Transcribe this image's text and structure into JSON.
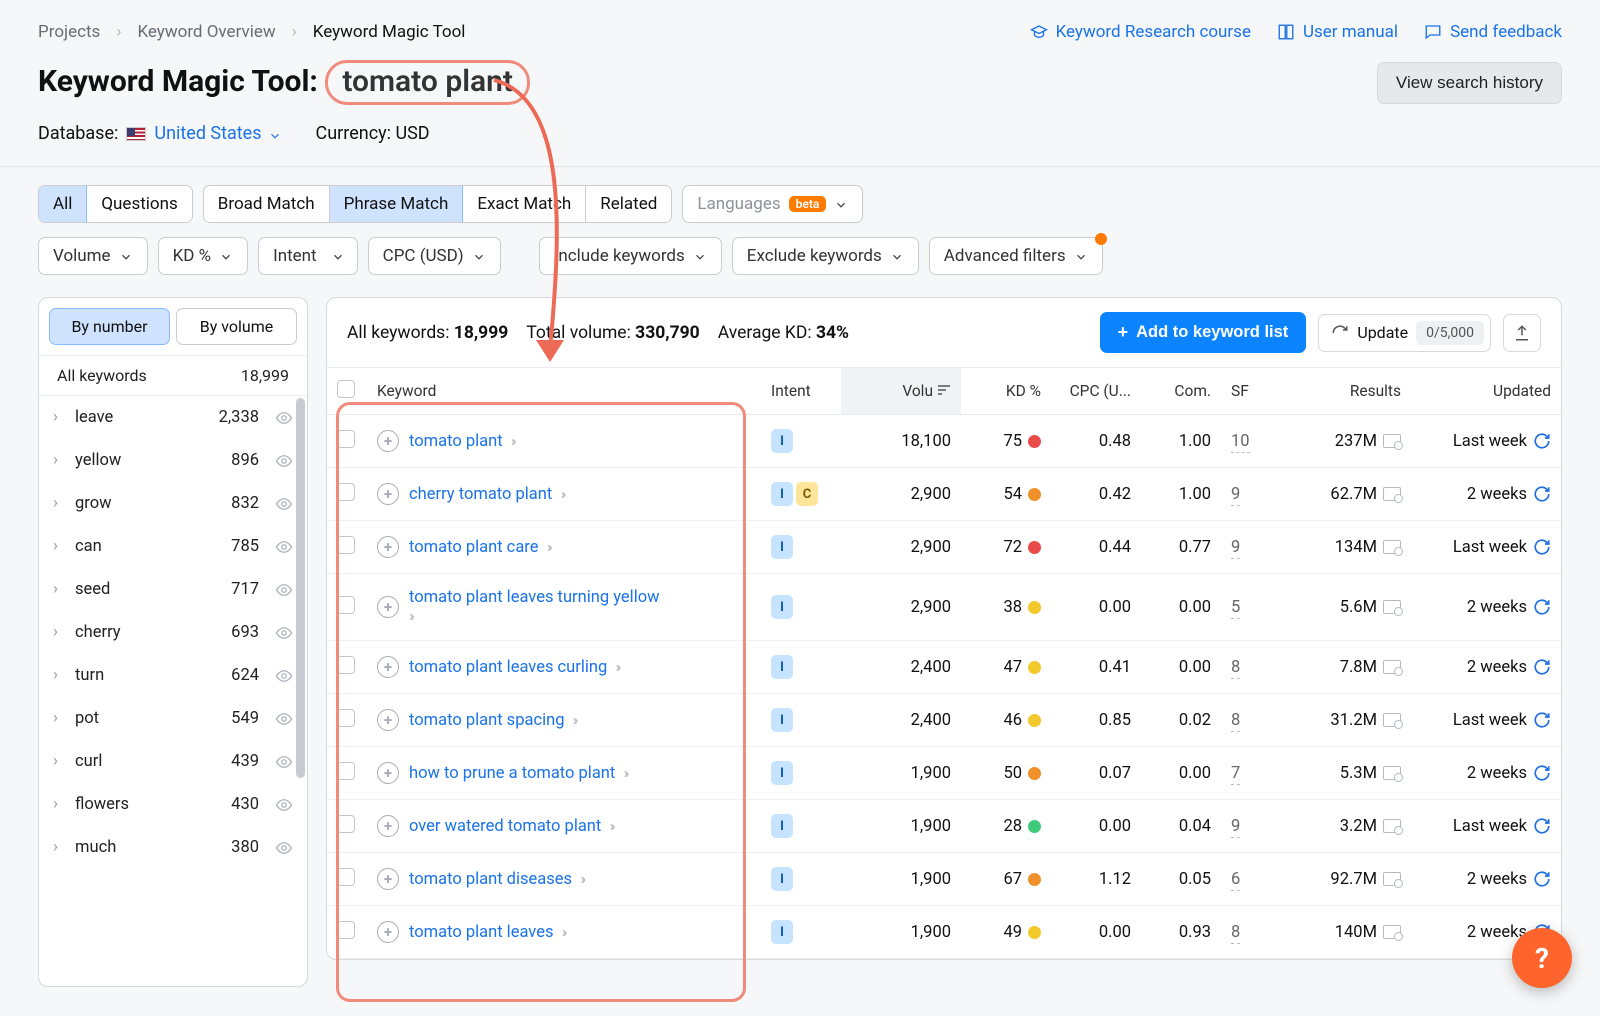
{
  "breadcrumb": {
    "a": "Projects",
    "b": "Keyword Overview",
    "c": "Keyword Magic Tool"
  },
  "top_links": {
    "course": "Keyword Research course",
    "manual": "User manual",
    "feedback": "Send feedback"
  },
  "title": {
    "prefix": "Keyword Magic Tool:",
    "keyword": "tomato plant"
  },
  "history_btn": "View search history",
  "meta": {
    "db_label": "Database:",
    "db_value": "United States",
    "currency": "Currency: USD"
  },
  "seg1": {
    "all": "All",
    "questions": "Questions"
  },
  "seg2": {
    "broad": "Broad Match",
    "phrase": "Phrase Match",
    "exact": "Exact Match",
    "related": "Related"
  },
  "lang_pill": {
    "label": "Languages",
    "badge": "beta"
  },
  "filter_pills": {
    "volume": "Volume",
    "kd": "KD %",
    "intent": "Intent",
    "cpc": "CPC (USD)",
    "include": "Include keywords",
    "exclude": "Exclude keywords",
    "advanced": "Advanced filters"
  },
  "sidebar": {
    "tab_number": "By number",
    "tab_volume": "By volume",
    "head_label": "All keywords",
    "head_count": "18,999",
    "items": [
      {
        "kw": "leave",
        "cnt": "2,338"
      },
      {
        "kw": "yellow",
        "cnt": "896"
      },
      {
        "kw": "grow",
        "cnt": "832"
      },
      {
        "kw": "can",
        "cnt": "785"
      },
      {
        "kw": "seed",
        "cnt": "717"
      },
      {
        "kw": "cherry",
        "cnt": "693"
      },
      {
        "kw": "turn",
        "cnt": "624"
      },
      {
        "kw": "pot",
        "cnt": "549"
      },
      {
        "kw": "curl",
        "cnt": "439"
      },
      {
        "kw": "flowers",
        "cnt": "430"
      },
      {
        "kw": "much",
        "cnt": "380"
      }
    ]
  },
  "panel": {
    "stats": {
      "all_label": "All keywords: ",
      "all_val": "18,999",
      "vol_label": "Total volume: ",
      "vol_val": "330,790",
      "kd_label": "Average KD: ",
      "kd_val": "34%"
    },
    "add_btn": "Add to keyword list",
    "update_btn": "Update",
    "update_count": "0/5,000"
  },
  "columns": {
    "keyword": "Keyword",
    "intent": "Intent",
    "volume": "Volu",
    "kd": "KD %",
    "cpc": "CPC (U...",
    "com": "Com.",
    "sf": "SF",
    "results": "Results",
    "updated": "Updated"
  },
  "rows": [
    {
      "kw": "tomato plant",
      "intent": [
        "I"
      ],
      "vol": "18,100",
      "kd": "75",
      "kdColor": "#e94b4b",
      "cpc": "0.48",
      "com": "1.00",
      "sf": "10",
      "res": "237M",
      "upd": "Last week"
    },
    {
      "kw": "cherry tomato plant",
      "intent": [
        "I",
        "C"
      ],
      "vol": "2,900",
      "kd": "54",
      "kdColor": "#f0902b",
      "cpc": "0.42",
      "com": "1.00",
      "sf": "9",
      "res": "62.7M",
      "upd": "2 weeks"
    },
    {
      "kw": "tomato plant care",
      "intent": [
        "I"
      ],
      "vol": "2,900",
      "kd": "72",
      "kdColor": "#e94b4b",
      "cpc": "0.44",
      "com": "0.77",
      "sf": "9",
      "res": "134M",
      "upd": "Last week"
    },
    {
      "kw": "tomato plant leaves turning yellow",
      "intent": [
        "I"
      ],
      "vol": "2,900",
      "kd": "38",
      "kdColor": "#f2c82d",
      "cpc": "0.00",
      "com": "0.00",
      "sf": "5",
      "res": "5.6M",
      "upd": "2 weeks",
      "wrap": true
    },
    {
      "kw": "tomato plant leaves curling",
      "intent": [
        "I"
      ],
      "vol": "2,400",
      "kd": "47",
      "kdColor": "#f2c82d",
      "cpc": "0.41",
      "com": "0.00",
      "sf": "8",
      "res": "7.8M",
      "upd": "2 weeks"
    },
    {
      "kw": "tomato plant spacing",
      "intent": [
        "I"
      ],
      "vol": "2,400",
      "kd": "46",
      "kdColor": "#f2c82d",
      "cpc": "0.85",
      "com": "0.02",
      "sf": "8",
      "res": "31.2M",
      "upd": "Last week"
    },
    {
      "kw": "how to prune a tomato plant",
      "intent": [
        "I"
      ],
      "vol": "1,900",
      "kd": "50",
      "kdColor": "#f0902b",
      "cpc": "0.07",
      "com": "0.00",
      "sf": "7",
      "res": "5.3M",
      "upd": "2 weeks"
    },
    {
      "kw": "over watered tomato plant",
      "intent": [
        "I"
      ],
      "vol": "1,900",
      "kd": "28",
      "kdColor": "#3ec97b",
      "cpc": "0.00",
      "com": "0.04",
      "sf": "9",
      "res": "3.2M",
      "upd": "Last week"
    },
    {
      "kw": "tomato plant diseases",
      "intent": [
        "I"
      ],
      "vol": "1,900",
      "kd": "67",
      "kdColor": "#f0902b",
      "cpc": "1.12",
      "com": "0.05",
      "sf": "6",
      "res": "92.7M",
      "upd": "2 weeks"
    },
    {
      "kw": "tomato plant leaves",
      "intent": [
        "I"
      ],
      "vol": "1,900",
      "kd": "49",
      "kdColor": "#f2c82d",
      "cpc": "0.00",
      "com": "0.93",
      "sf": "8",
      "res": "140M",
      "upd": "2 weeks"
    }
  ],
  "fab": "?"
}
